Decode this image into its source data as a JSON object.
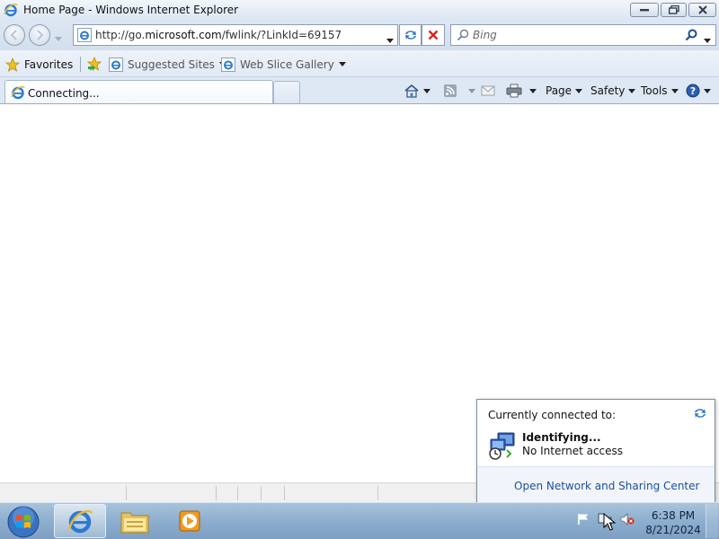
{
  "window": {
    "title": "Home Page - Windows Internet Explorer",
    "controls": [
      "minimize",
      "maximize",
      "close"
    ]
  },
  "navigation": {
    "address_url_prefix": "http://go.",
    "address_url_domain": "microsoft.com",
    "address_url_suffix": "/fwlink/?LinkId=69157",
    "search_placeholder": "Bing"
  },
  "favorites_bar": {
    "favorites_label": "Favorites",
    "links": [
      {
        "label": "Suggested Sites"
      },
      {
        "label": "Web Slice Gallery"
      }
    ]
  },
  "tabs": [
    {
      "label": "Connecting...",
      "active": true
    }
  ],
  "command_bar": {
    "page_label": "Page",
    "safety_label": "Safety",
    "tools_label": "Tools"
  },
  "network_flyout": {
    "header": "Currently connected to:",
    "network_name": "Identifying...",
    "network_status": "No Internet access",
    "footer_link": "Open Network and Sharing Center"
  },
  "taskbar": {
    "pinned": [
      "internet-explorer",
      "windows-explorer",
      "media-player"
    ],
    "clock_time": "6:38 PM",
    "clock_date": "8/21/2024"
  },
  "colors": {
    "chrome_blue": "#dbe6f3",
    "taskbar_blue": "#8fb0cf",
    "link_blue": "#1c4f9c",
    "stop_red": "#d9261c"
  }
}
